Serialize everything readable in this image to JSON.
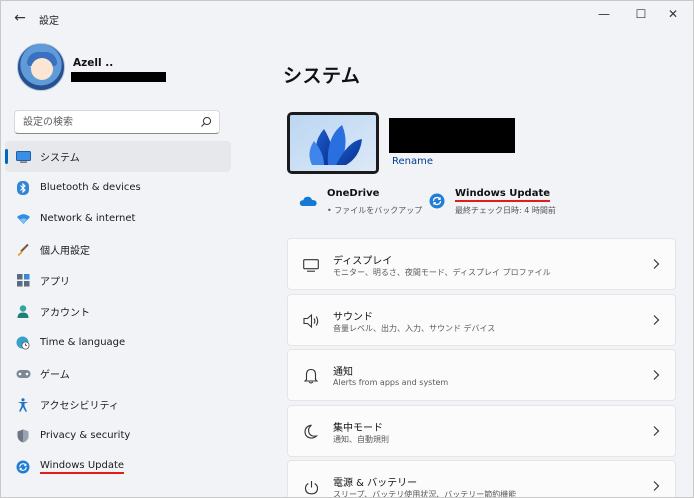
{
  "window": {
    "title": "設定",
    "minimize_glyph": "—",
    "maximize_glyph": "☐",
    "close_glyph": "✕",
    "back_glyph": "←"
  },
  "profile": {
    "name": "Azell .."
  },
  "search": {
    "placeholder": "設定の検索"
  },
  "sidebar": {
    "items": [
      {
        "label": "システム",
        "icon": "system-icon",
        "active": true
      },
      {
        "label": "Bluetooth & devices",
        "icon": "bluetooth-icon"
      },
      {
        "label": "Network & internet",
        "icon": "wifi-icon"
      },
      {
        "label": "個人用設定",
        "icon": "brush-icon"
      },
      {
        "label": "アプリ",
        "icon": "apps-icon"
      },
      {
        "label": "アカウント",
        "icon": "account-icon"
      },
      {
        "label": "Time & language",
        "icon": "globe-clock-icon"
      },
      {
        "label": "ゲーム",
        "icon": "gamepad-icon"
      },
      {
        "label": "アクセシビリティ",
        "icon": "accessibility-icon"
      },
      {
        "label": "Privacy & security",
        "icon": "shield-icon"
      },
      {
        "label": "Windows Update",
        "icon": "update-icon",
        "highlight": true
      }
    ]
  },
  "main": {
    "title": "システム",
    "rename_label": "Rename",
    "quick": {
      "onedrive": {
        "title": "OneDrive",
        "sub": "• ファイルをバックアップ"
      },
      "update": {
        "title": "Windows Update",
        "sub": "最終チェック日時: 4 時間前"
      }
    },
    "cards": [
      {
        "title": "ディスプレイ",
        "sub": "モニター、明るさ、夜間モード、ディスプレイ プロファイル",
        "icon": "display-icon"
      },
      {
        "title": "サウンド",
        "sub": "音量レベル、出力、入力、サウンド デバイス",
        "icon": "speaker-icon"
      },
      {
        "title": "通知",
        "sub": "Alerts from apps and system",
        "icon": "bell-icon"
      },
      {
        "title": "集中モード",
        "sub": "通知、自動規則",
        "icon": "moon-icon"
      },
      {
        "title": "電源 & バッテリー",
        "sub": "スリープ、バッテリ使用状況、バッテリー節約機能",
        "icon": "power-icon"
      }
    ]
  },
  "colors": {
    "accent": "#0067c0",
    "highlight_underline": "#e21b1b",
    "link": "#003e92"
  }
}
